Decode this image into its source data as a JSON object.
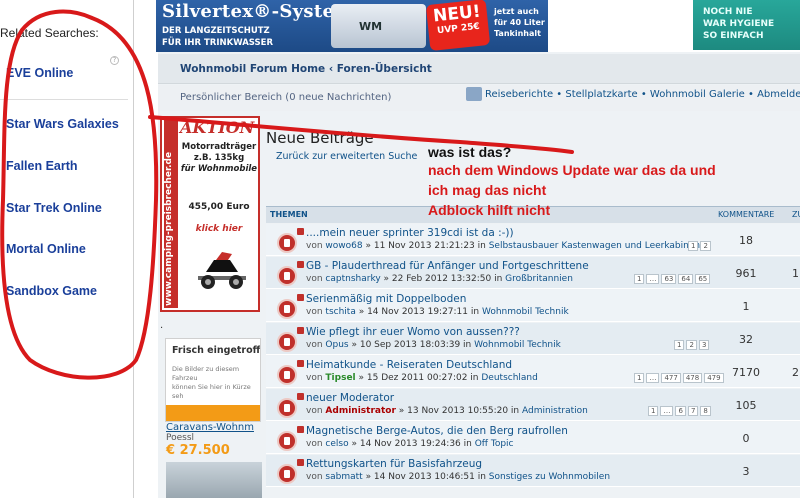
{
  "left_panel": {
    "title": "Related Searches:",
    "help_icon": "help-icon",
    "items": [
      {
        "label": "EVE Online"
      },
      {
        "label": "Star Wars Galaxies"
      },
      {
        "label": "Fallen Earth"
      },
      {
        "label": "Star Trek Online"
      },
      {
        "label": "Mortal Online"
      },
      {
        "label": "Sandbox Game"
      }
    ]
  },
  "banner_top": {
    "title": "Silvertex®-System",
    "sub1": "DER LANGZEITSCHUTZ",
    "sub2": "FÜR IHR TRINKWASSER",
    "product": "WM",
    "neu": "NEU!",
    "price": "UVP 25€",
    "right1": "jetzt auch",
    "right2": "für 40 Liter",
    "right3": "Tankinhalt"
  },
  "banner_right": {
    "line1": "NOCH NIE",
    "line2": "WAR HYGIENE",
    "line3": "SO EINFACH"
  },
  "navbar": {
    "breadcrumb": "Wohnmobil Forum Home ‹ Foren-Übersicht"
  },
  "userbar": {
    "left": "Persönlicher Bereich (0 neue Nachrichten)",
    "links": "Reiseberichte • Stellplatzkarte • Wohnmobil Galerie • Abmelden [ kit"
  },
  "ad_aktion": {
    "side": "www.camping-preisbrecher.de",
    "head": "AKTION",
    "body1": "Motorradträger",
    "body2": "z.B. 135kg",
    "body3": "für Wohnmobile",
    "price": "455,00 Euro",
    "click": "klick hier"
  },
  "ad_second": {
    "dot": ".",
    "head": "Frisch eingetroffe",
    "small1": "Die Bilder zu diesem Fahrzeu",
    "small2": "können Sie hier in Kürze seh",
    "title": "Caravans-Wohnm",
    "subtitle": "Poessl",
    "price": "€ 27.500"
  },
  "topics": {
    "title": "Neue Beiträge",
    "back_link": "Zurück zur erweiterten Suche",
    "col_topics": "THEMEN",
    "col_comments": "KOMMENTARE",
    "col_more": "ZU",
    "rows": [
      {
        "title": "....mein neuer sprinter 319cdi ist da :-))",
        "by": "von",
        "user": "wowo68",
        "meta": "» 11 Nov 2013 21:21:23 in",
        "forum": "Selbstausbauer Kastenwagen und Leerkabinen",
        "pages": [
          "1",
          "2"
        ],
        "count": "18",
        "extra": ""
      },
      {
        "title": "GB - Plauderthread für Anfänger und Fortgeschrittene",
        "by": "von",
        "user": "captnsharky",
        "meta": "» 22 Feb 2012 13:32:50 in",
        "forum": "Großbritannien",
        "pages": [
          "1",
          "…",
          "63",
          "64",
          "65"
        ],
        "count": "961",
        "extra": "1"
      },
      {
        "title": "Serienmäßig mit Doppelboden",
        "by": "von",
        "user": "tschita",
        "meta": "» 14 Nov 2013 19:27:11 in",
        "forum": "Wohnmobil Technik",
        "pages": [],
        "count": "1",
        "extra": ""
      },
      {
        "title": "Wie pflegt ihr euer Womo von aussen???",
        "by": "von",
        "user": "Opus",
        "meta": "» 10 Sep 2013 18:03:39 in",
        "forum": "Wohnmobil Technik",
        "pages": [
          "1",
          "2",
          "3"
        ],
        "count": "32",
        "extra": ""
      },
      {
        "title": "Heimatkunde - Reiseraten Deutschland",
        "by": "von",
        "user": "Tipsel",
        "meta": "» 15 Dez 2011 00:27:02 in",
        "forum": "Deutschland",
        "pages": [
          "1",
          "…",
          "477",
          "478",
          "479"
        ],
        "count": "7170",
        "extra": "2"
      },
      {
        "title": "neuer Moderator",
        "by": "von",
        "user": "Administrator",
        "meta": "» 13 Nov 2013 10:55:20 in",
        "forum": "Administration",
        "pages": [
          "1",
          "…",
          "6",
          "7",
          "8"
        ],
        "count": "105",
        "extra": ""
      },
      {
        "title": "Magnetische Berge-Autos, die den Berg raufrollen",
        "by": "von",
        "user": "celso",
        "meta": "» 14 Nov 2013 19:24:36 in",
        "forum": "Off Topic",
        "pages": [],
        "count": "0",
        "extra": ""
      },
      {
        "title": "Rettungskarten für Basisfahrzeug",
        "by": "von",
        "user": "sabmatt",
        "meta": "» 14 Nov 2013 10:46:51 in",
        "forum": "Sonstiges zu Wohnmobilen",
        "pages": [],
        "count": "3",
        "extra": ""
      }
    ]
  },
  "annotation": {
    "question": "was ist das?",
    "line1": "nach dem Windows Update war das da und",
    "line2": "ich mag das nicht",
    "line3": "Adblock hilft nicht",
    "color": "#d8191a"
  }
}
